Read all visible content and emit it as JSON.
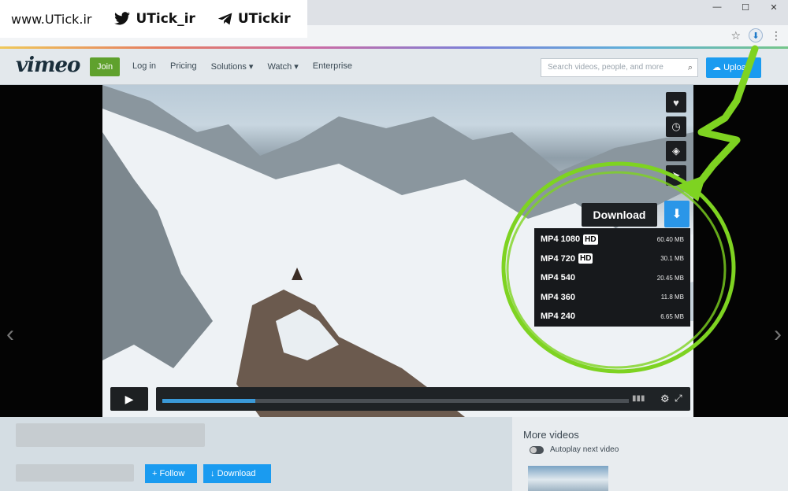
{
  "watermark": {
    "site": "www.UTick.ir",
    "twitter": "UTick_ir",
    "telegram": "UTickir"
  },
  "vimeo": {
    "logo": "vimeo",
    "join_label": "Join",
    "nav": [
      "Log in",
      "Pricing",
      "Solutions ▾",
      "Watch ▾",
      "Enterprise"
    ],
    "search_placeholder": "Search videos, people, and more",
    "upload_label": "Upload"
  },
  "player": {
    "side_actions": [
      "heart-icon",
      "clock-icon",
      "stack-icon",
      "share-icon"
    ],
    "download_label": "Download",
    "downloads": [
      {
        "format": "MP4 1080",
        "hd": "HD",
        "size": "60.40 MB"
      },
      {
        "format": "MP4 720",
        "hd": "HD",
        "size": "30.1 MB"
      },
      {
        "format": "MP4 540",
        "hd": "",
        "size": "20.45 MB"
      },
      {
        "format": "MP4 360",
        "hd": "",
        "size": "11.8 MB"
      },
      {
        "format": "MP4 240",
        "hd": "",
        "size": "6.65 MB"
      }
    ],
    "progress": 0.2
  },
  "below": {
    "follow_label": "+ Follow",
    "download_label": "Download",
    "more_videos": "More videos",
    "autoplay_label": "Autoplay next video"
  },
  "colors": {
    "accent": "#1a9bf0",
    "join": "#5fa12d",
    "annotation": "#7ed321"
  }
}
